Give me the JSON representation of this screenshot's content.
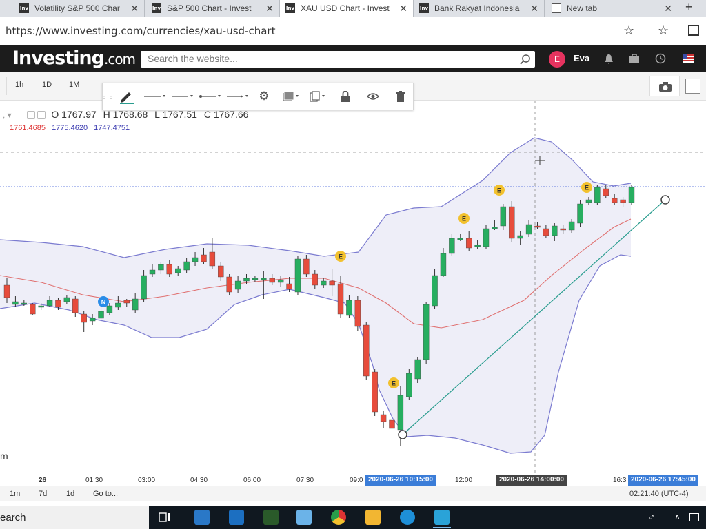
{
  "browser": {
    "tabs": [
      {
        "title": "Volatility S&P 500 Char",
        "active": false
      },
      {
        "title": "S&P 500 Chart - Invest",
        "active": false
      },
      {
        "title": "XAU USD Chart - Invest",
        "active": true
      },
      {
        "title": "Bank Rakyat Indonesia",
        "active": false
      },
      {
        "title": "New tab",
        "active": false
      }
    ],
    "favicon_label": "Inv",
    "url": "https://www.investing.com/currencies/xau-usd-chart"
  },
  "site": {
    "logo_main": "Investing",
    "logo_suffix": ".com",
    "search_placeholder": "Search the website...",
    "avatar_letter": "E",
    "user_name": "Eva"
  },
  "timeframes": [
    "1h",
    "1D",
    "1M"
  ],
  "ohlc": {
    "open": "O 1767.97",
    "high": "H 1768.68",
    "low": "L 1767.51",
    "close": "C 1767.66"
  },
  "bollinger": {
    "basis": "1761.4685",
    "upper": "1775.4620",
    "lower": "1747.4751"
  },
  "chart_data": {
    "type": "candlestick",
    "x_labels": [
      "26",
      "01:30",
      "03:00",
      "04:30",
      "06:00",
      "07:30",
      "09:0",
      "12:00",
      "16:3"
    ],
    "x_badges": [
      {
        "label": "2020-06-26 10:15:00",
        "color": "#3b7dd8"
      },
      {
        "label": "2020-06-26 14:00:00",
        "color": "#444444"
      },
      {
        "label": "2020-06-26 17:45:00",
        "color": "#3b7dd8"
      }
    ],
    "event_markers": [
      "N",
      "E",
      "E",
      "E",
      "E",
      "E"
    ],
    "colors": {
      "up": "#27ae60",
      "down": "#e74c3c",
      "band_fill": "#e8e8f5",
      "band_line": "#7b7bd0",
      "basis_line": "#e07070",
      "trend_line": "#2a9d8f"
    },
    "candles": [
      [
        414,
        432,
        404,
        440,
        "d"
      ],
      [
        438,
        442,
        430,
        446,
        "u"
      ],
      [
        440,
        440,
        436,
        444,
        "u"
      ],
      [
        442,
        456,
        440,
        458,
        "d"
      ],
      [
        446,
        444,
        440,
        450,
        "u"
      ],
      [
        444,
        436,
        430,
        446,
        "u"
      ],
      [
        436,
        446,
        432,
        450,
        "d"
      ],
      [
        438,
        432,
        428,
        442,
        "u"
      ],
      [
        434,
        454,
        430,
        460,
        "d"
      ],
      [
        456,
        468,
        452,
        482,
        "d"
      ],
      [
        466,
        462,
        456,
        472,
        "u"
      ],
      [
        462,
        452,
        446,
        466,
        "u"
      ],
      [
        454,
        444,
        440,
        458,
        "u"
      ],
      [
        446,
        440,
        430,
        450,
        "u"
      ],
      [
        440,
        436,
        434,
        446,
        "d"
      ],
      [
        450,
        434,
        426,
        454,
        "u"
      ],
      [
        434,
        400,
        392,
        438,
        "u"
      ],
      [
        398,
        392,
        384,
        402,
        "u"
      ],
      [
        392,
        384,
        380,
        398,
        "u"
      ],
      [
        384,
        398,
        378,
        402,
        "d"
      ],
      [
        396,
        390,
        386,
        400,
        "u"
      ],
      [
        392,
        380,
        374,
        396,
        "u"
      ],
      [
        380,
        374,
        366,
        386,
        "u"
      ],
      [
        370,
        380,
        360,
        384,
        "d"
      ],
      [
        366,
        386,
        346,
        390,
        "d"
      ],
      [
        386,
        402,
        380,
        408,
        "d"
      ],
      [
        402,
        424,
        398,
        428,
        "d"
      ],
      [
        420,
        408,
        400,
        426,
        "u"
      ],
      [
        408,
        404,
        398,
        412,
        "u"
      ],
      [
        406,
        404,
        400,
        410,
        "u"
      ],
      [
        404,
        404,
        394,
        434,
        "u"
      ],
      [
        404,
        410,
        398,
        414,
        "d"
      ],
      [
        410,
        406,
        400,
        416,
        "u"
      ],
      [
        412,
        420,
        402,
        424,
        "d"
      ],
      [
        424,
        376,
        372,
        428,
        "u"
      ],
      [
        376,
        398,
        370,
        402,
        "d"
      ],
      [
        398,
        414,
        392,
        420,
        "d"
      ],
      [
        414,
        408,
        404,
        418,
        "u"
      ],
      [
        408,
        414,
        390,
        430,
        "d"
      ],
      [
        412,
        456,
        400,
        462,
        "d"
      ],
      [
        458,
        436,
        428,
        462,
        "u"
      ],
      [
        436,
        474,
        430,
        480,
        "d"
      ],
      [
        472,
        546,
        468,
        552,
        "d"
      ],
      [
        540,
        598,
        536,
        604,
        "d"
      ],
      [
        602,
        612,
        596,
        622,
        "d"
      ],
      [
        610,
        622,
        604,
        628,
        "d"
      ],
      [
        624,
        574,
        560,
        648,
        "u"
      ],
      [
        576,
        542,
        536,
        580,
        "u"
      ],
      [
        550,
        522,
        518,
        556,
        "u"
      ],
      [
        522,
        442,
        438,
        528,
        "u"
      ],
      [
        444,
        400,
        390,
        448,
        "u"
      ],
      [
        400,
        368,
        360,
        402,
        "u"
      ],
      [
        368,
        346,
        340,
        372,
        "u"
      ],
      [
        346,
        346,
        340,
        350,
        "u"
      ],
      [
        346,
        360,
        336,
        364,
        "d"
      ],
      [
        358,
        356,
        348,
        362,
        "u"
      ],
      [
        358,
        332,
        326,
        362,
        "u"
      ],
      [
        330,
        330,
        320,
        334,
        "u"
      ],
      [
        328,
        300,
        296,
        334,
        "u"
      ],
      [
        300,
        346,
        292,
        352,
        "d"
      ],
      [
        346,
        342,
        336,
        356,
        "u"
      ],
      [
        340,
        326,
        320,
        344,
        "u"
      ],
      [
        328,
        328,
        322,
        332,
        "d"
      ],
      [
        332,
        342,
        326,
        346,
        "d"
      ],
      [
        342,
        328,
        324,
        350,
        "u"
      ],
      [
        332,
        334,
        326,
        340,
        "d"
      ],
      [
        334,
        322,
        318,
        338,
        "u"
      ],
      [
        324,
        296,
        290,
        330,
        "u"
      ],
      [
        294,
        290,
        286,
        298,
        "u"
      ],
      [
        272,
        294,
        268,
        298,
        "u"
      ],
      [
        274,
        284,
        268,
        288,
        "d"
      ],
      [
        288,
        294,
        282,
        298,
        "d"
      ],
      [
        290,
        294,
        286,
        300,
        "d"
      ],
      [
        294,
        272,
        268,
        298,
        "u"
      ]
    ]
  },
  "bottom_bar": {
    "ranges": [
      "1m",
      "7d",
      "1d"
    ],
    "goto": "Go to...",
    "clock": "02:21:40 (UTC-4)"
  },
  "taskbar": {
    "search": "earch"
  },
  "right_label": "m"
}
